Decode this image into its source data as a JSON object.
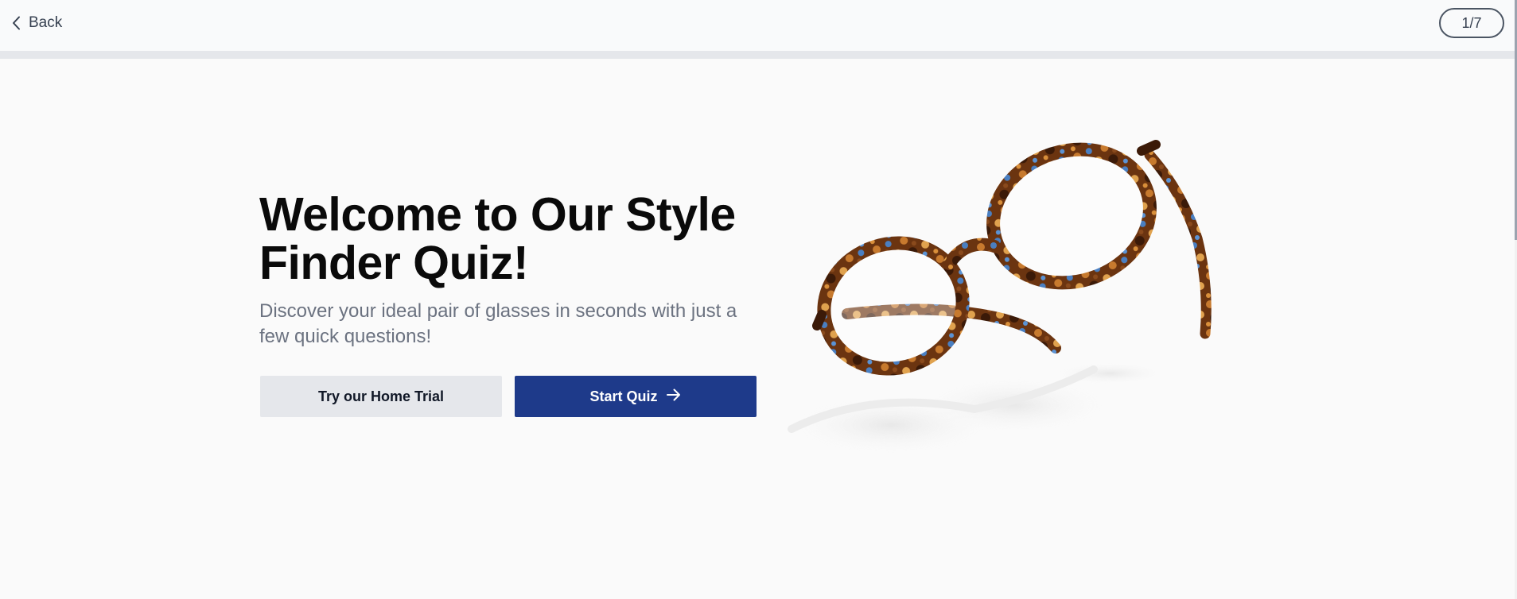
{
  "header": {
    "back_label": "Back",
    "step_indicator": "1/7",
    "progress_fraction": 0.14
  },
  "hero": {
    "title": "Welcome to Our Style Finder Quiz!",
    "subtitle": "Discover your ideal pair of glasses in seconds with just a few quick questions!",
    "secondary_button": "Try our Home Trial",
    "primary_button": "Start Quiz",
    "image_icon": "eyeglasses-photo"
  },
  "colors": {
    "primary": "#1e3a8a",
    "secondary": "#e5e7eb",
    "text": "#0a0a0a",
    "muted": "#6b7280"
  }
}
